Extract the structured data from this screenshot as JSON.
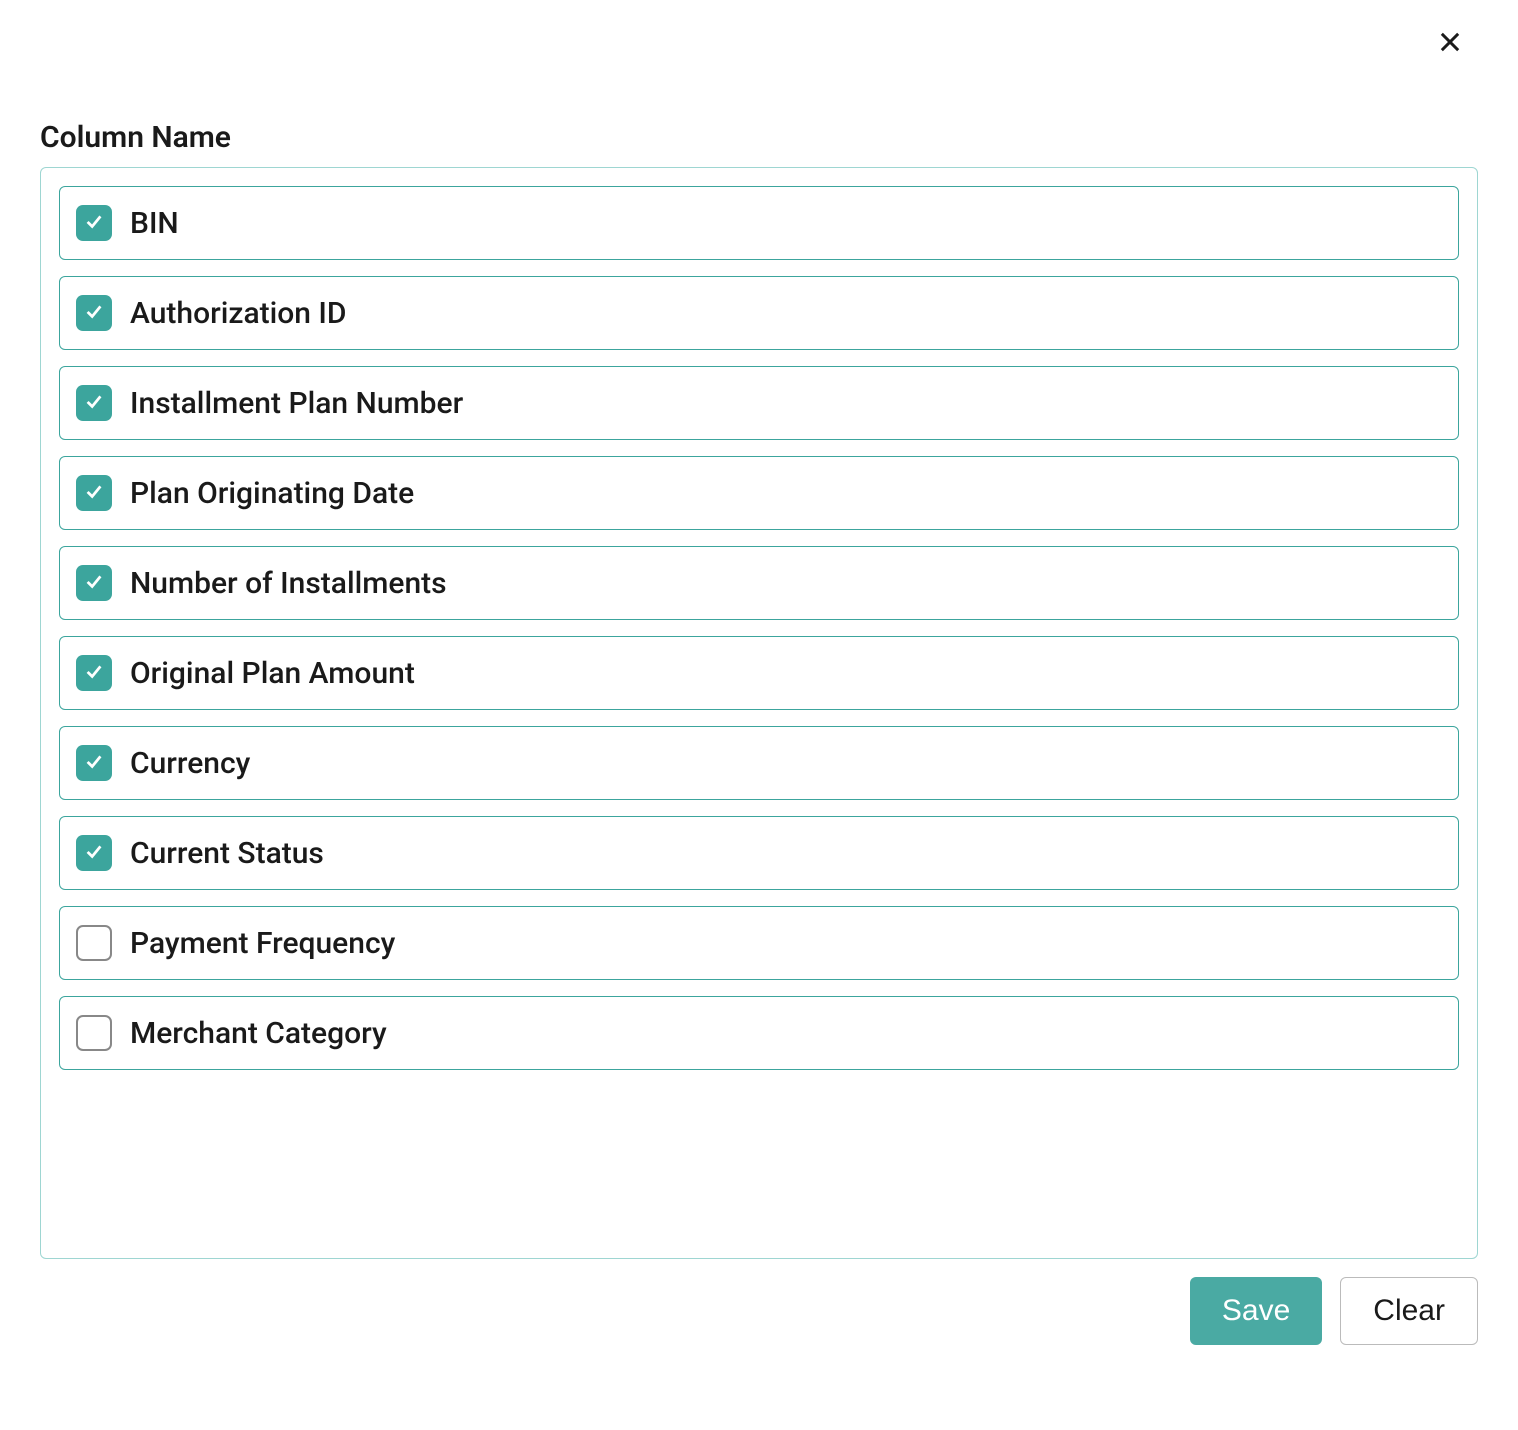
{
  "title": "Column Name",
  "columns": [
    {
      "label": "BIN",
      "checked": true
    },
    {
      "label": "Authorization ID",
      "checked": true
    },
    {
      "label": "Installment Plan Number",
      "checked": true
    },
    {
      "label": "Plan Originating Date",
      "checked": true
    },
    {
      "label": "Number of Installments",
      "checked": true
    },
    {
      "label": "Original Plan Amount",
      "checked": true
    },
    {
      "label": "Currency",
      "checked": true
    },
    {
      "label": "Current Status",
      "checked": true
    },
    {
      "label": "Payment Frequency",
      "checked": false
    },
    {
      "label": "Merchant Category",
      "checked": false
    }
  ],
  "buttons": {
    "save": "Save",
    "clear": "Clear"
  }
}
